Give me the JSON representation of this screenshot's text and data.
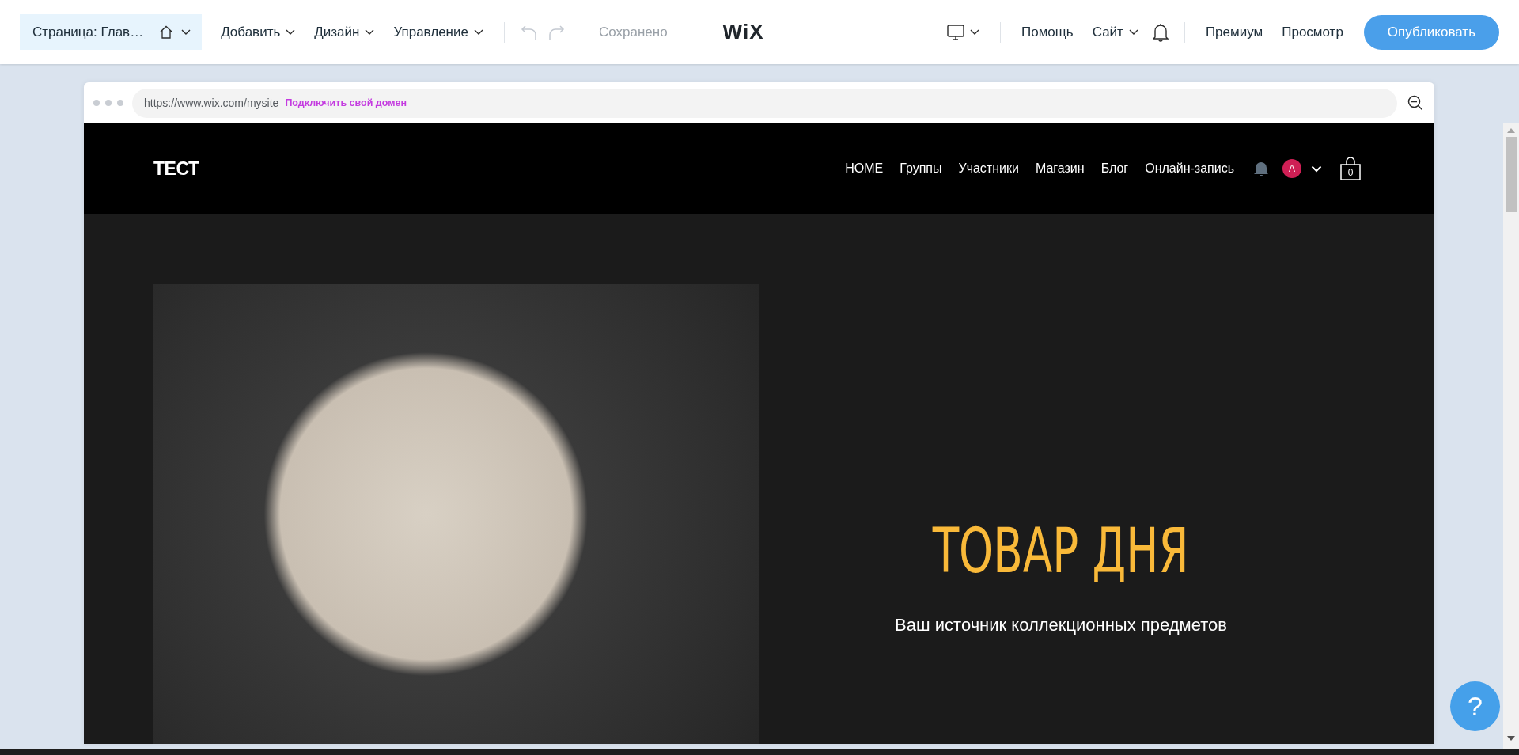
{
  "editor_bar": {
    "page_selector": "Страница: Глав…",
    "menus": [
      {
        "label": "Добавить"
      },
      {
        "label": "Дизайн"
      },
      {
        "label": "Управление"
      }
    ],
    "save_status": "Сохранено",
    "logo": "WiX",
    "right_items": [
      {
        "kind": "device"
      },
      {
        "kind": "link",
        "label": "Помощь"
      },
      {
        "kind": "menu",
        "label": "Сайт"
      },
      {
        "kind": "bell"
      },
      {
        "kind": "divider"
      },
      {
        "kind": "link",
        "label": "Премиум"
      },
      {
        "kind": "link",
        "label": "Просмотр"
      }
    ],
    "publish_button": "Опубликовать"
  },
  "browser": {
    "url": "https://www.wix.com/mysite",
    "connect_domain": "Подключить свой домен"
  },
  "site": {
    "logo": "ТЕСТ",
    "nav": [
      {
        "label": "HOME"
      },
      {
        "label": "Группы"
      },
      {
        "label": "Участники"
      },
      {
        "label": "Магазин"
      },
      {
        "label": "Блог"
      },
      {
        "label": "Онлайн-запись"
      }
    ],
    "avatar": "A",
    "cart_count": "0",
    "hero": {
      "title": "ТОВАР ДНЯ",
      "subtitle": "Ваш источник коллекционных предметов"
    }
  },
  "help_button": "?"
}
